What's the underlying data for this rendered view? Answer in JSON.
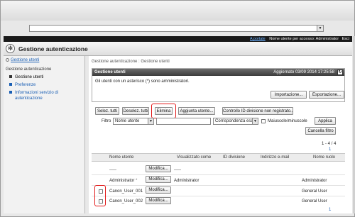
{
  "browser": {
    "address_value": ""
  },
  "header": {
    "portal_link": "A portale",
    "user_label": "Nome utente per accesso: Administrator",
    "exit_link": "Esci"
  },
  "app": {
    "logo_glyph": "✻",
    "title": "Gestione autenticazione"
  },
  "sidebar": {
    "crumb": "Gestione utenti",
    "section": "Gestione autenticazione",
    "items": [
      {
        "label": "Gestione utenti"
      },
      {
        "label": "Preferenze"
      },
      {
        "label": "Informazioni servizio di"
      },
      {
        "label": "autenticazione"
      }
    ]
  },
  "main": {
    "breadcrumb": "Gestione autenticazione : Gestione utenti",
    "card": {
      "title": "Gestione utenti",
      "updated": "Aggiornato 03/09 2014 17:25:58",
      "refresh_glyph": "↻",
      "note": "Gli utenti con un asterisco (*) sono amministratori.",
      "import_label": "Importazione...",
      "export_label": "Esportazione..."
    },
    "toolbar": {
      "select_all": "Selez. tutti",
      "deselect_all": "Deselez. tutti",
      "delete": "Elimina",
      "add_user": "Aggiunta utente...",
      "dept_check": "Controllo ID divisione non registrato..."
    },
    "filter": {
      "label": "Filtro",
      "field_value": "Nome utente",
      "match_value": "Corrispondenza esatta",
      "case_label": "Maiuscole/minuscole",
      "apply": "Applica",
      "clear": "Cancella filtro"
    },
    "pager": {
      "range": "1 - 4 / 4",
      "page": "1"
    },
    "columns": [
      "Nome utente",
      "Visualizzato come",
      "ID divisione",
      "Indirizzo e-mail",
      "Nome ruolo"
    ],
    "rows": [
      {
        "name": "-----",
        "display": "-----",
        "role": "",
        "modify": "Modifica..."
      },
      {
        "name": "Administrator",
        "marker": "*",
        "display": "Administrator",
        "role": "Administrator",
        "modify": "Modifica..."
      },
      {
        "name": "Canon_User_001",
        "display": "",
        "role": "General User",
        "modify": "Modifica..."
      },
      {
        "name": "Canon_User_002",
        "display": "",
        "role": "General User",
        "modify": "Modifica..."
      }
    ],
    "footer_page": "1"
  },
  "colors": {
    "highlight": "#e21a1a",
    "link": "#1a5fb4",
    "dark_bar": "#1a1a1a"
  }
}
